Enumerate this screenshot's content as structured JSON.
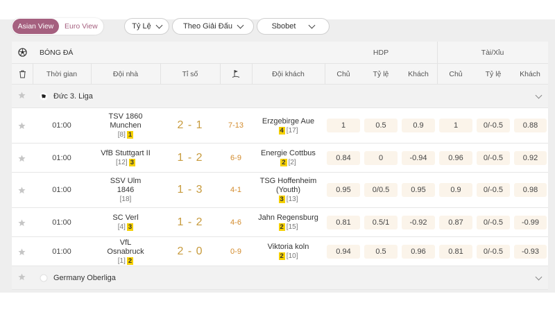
{
  "view_toggle": {
    "asian": "Asian View",
    "euro": "Euro View"
  },
  "filters": {
    "odds_type": "Tỷ Lệ",
    "sort_by": "Theo Giải Đấu",
    "bookmaker": "Sbobet"
  },
  "header": {
    "sport": "BÓNG ĐÁ",
    "hdp": "HDP",
    "ou": "Tài/Xỉu",
    "columns": {
      "time": "Thời gian",
      "home": "Đội nhà",
      "score": "Tỉ số",
      "away": "Đội khách",
      "hdp_home": "Chủ",
      "hdp_line": "Tỷ lệ",
      "hdp_away": "Khách",
      "ou_home": "Chủ",
      "ou_line": "Tỷ lệ",
      "ou_away": "Khách"
    }
  },
  "leagues": [
    {
      "name": "Đức 3. Liga",
      "matches": [
        {
          "time": "01:00",
          "home": "TSV 1860 Munchen",
          "home_rank": "[8]",
          "home_cards": "1",
          "score": "2 - 1",
          "corners": "7-13",
          "away": "Erzgebirge Aue",
          "away_rank": "[17]",
          "away_cards": "4",
          "hdp_home": "1",
          "hdp_line": "0.5",
          "hdp_away": "0.9",
          "ou_home": "1",
          "ou_line": "0/-0.5",
          "ou_away": "0.88"
        },
        {
          "time": "01:00",
          "home": "VfB Stuttgart II",
          "home_rank": "[12]",
          "home_cards": "3",
          "score": "1 - 2",
          "corners": "6-9",
          "away": "Energie Cottbus",
          "away_rank": "[2]",
          "away_cards": "2",
          "hdp_home": "0.84",
          "hdp_line": "0",
          "hdp_away": "-0.94",
          "ou_home": "0.96",
          "ou_line": "0/-0.5",
          "ou_away": "0.92"
        },
        {
          "time": "01:00",
          "home": "SSV Ulm 1846",
          "home_rank": "[18]",
          "home_cards": "",
          "score": "1 - 3",
          "corners": "4-1",
          "away": "TSG Hoffenheim (Youth)",
          "away_rank": "[13]",
          "away_cards": "3",
          "hdp_home": "0.95",
          "hdp_line": "0/0.5",
          "hdp_away": "0.95",
          "ou_home": "0.9",
          "ou_line": "0/-0.5",
          "ou_away": "0.98"
        },
        {
          "time": "01:00",
          "home": "SC Verl",
          "home_rank": "[4]",
          "home_cards": "3",
          "score": "1 - 2",
          "corners": "4-6",
          "away": "Jahn Regensburg",
          "away_rank": "[15]",
          "away_cards": "2",
          "hdp_home": "0.81",
          "hdp_line": "0.5/1",
          "hdp_away": "-0.92",
          "ou_home": "0.87",
          "ou_line": "0/-0.5",
          "ou_away": "-0.99"
        },
        {
          "time": "01:00",
          "home": "VfL Osnabruck",
          "home_rank": "[1]",
          "home_cards": "2",
          "score": "2 - 0",
          "corners": "0-9",
          "away": "Viktoria koln",
          "away_rank": "[10]",
          "away_cards": "2",
          "hdp_home": "0.94",
          "hdp_line": "0.5",
          "hdp_away": "0.96",
          "ou_home": "0.81",
          "ou_line": "0/-0.5",
          "ou_away": "-0.93"
        }
      ]
    },
    {
      "name": "Germany Oberliga",
      "matches": []
    }
  ],
  "colors": {
    "accent": "#a5607f",
    "score": "#c79a3c",
    "corners": "#d38b2c",
    "badge": "#f5d000",
    "odds_bg": "#fbf4ea"
  },
  "icons": {
    "sport": "soccer-ball-icon",
    "delete": "trash-icon",
    "corners": "corner-flag-icon",
    "favorite": "star-icon",
    "league_flag": "germany-flag-icon",
    "expand": "chevron-down-icon"
  }
}
